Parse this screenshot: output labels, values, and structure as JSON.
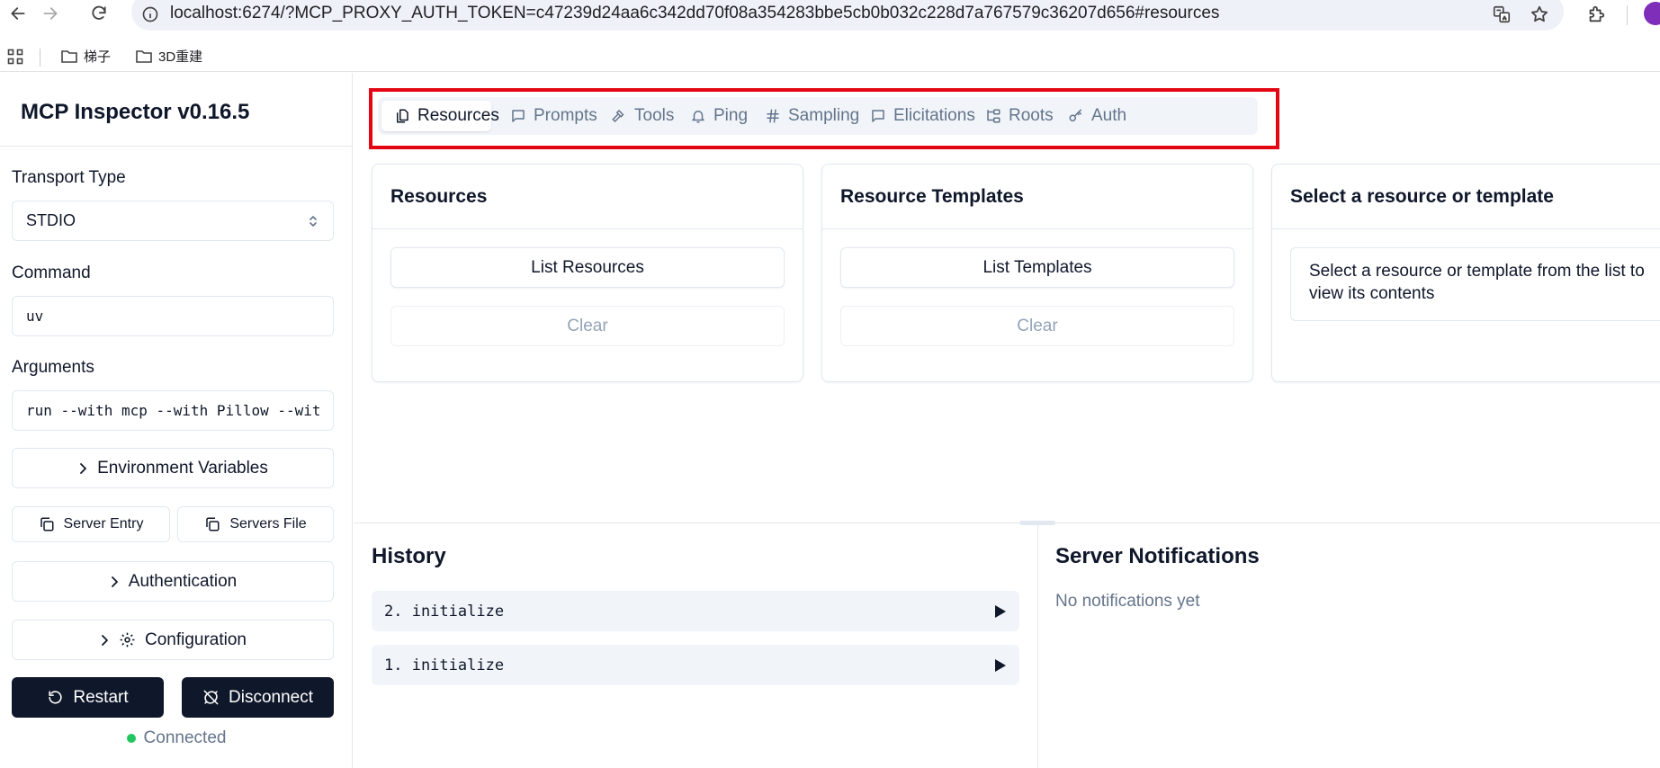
{
  "browser": {
    "url": "localhost:6274/?MCP_PROXY_AUTH_TOKEN=c47239d24aa6c342dd70f08a354283bbe5cb0b032c228d7a767579c36207d656#resources",
    "bookmarks": [
      {
        "label": "梯子"
      },
      {
        "label": "3D重建"
      }
    ]
  },
  "sidebar": {
    "title": "MCP Inspector v0.16.5",
    "transport_label": "Transport Type",
    "transport_value": "STDIO",
    "command_label": "Command",
    "command_value": "uv",
    "arguments_label": "Arguments",
    "arguments_value": "run --with mcp --with Pillow --wit",
    "env_label": "Environment Variables",
    "server_entry_label": "Server Entry",
    "servers_file_label": "Servers File",
    "auth_label": "Authentication",
    "config_label": "Configuration",
    "restart_label": "Restart",
    "disconnect_label": "Disconnect",
    "status_text": "Connected",
    "status_color": "#22c55e"
  },
  "tabs": [
    {
      "label": "Resources",
      "icon": "files-icon",
      "active": true
    },
    {
      "label": "Prompts",
      "icon": "message-square-icon"
    },
    {
      "label": "Tools",
      "icon": "hammer-icon"
    },
    {
      "label": "Ping",
      "icon": "bell-icon"
    },
    {
      "label": "Sampling",
      "icon": "hash-icon"
    },
    {
      "label": "Elicitations",
      "icon": "message-square-icon"
    },
    {
      "label": "Roots",
      "icon": "folder-tree-icon"
    },
    {
      "label": "Auth",
      "icon": "key-icon"
    }
  ],
  "highlight_color": "#e30613",
  "resources_card": {
    "title": "Resources",
    "list_label": "List Resources",
    "clear_label": "Clear"
  },
  "templates_card": {
    "title": "Resource Templates",
    "list_label": "List Templates",
    "clear_label": "Clear"
  },
  "detail_card": {
    "title": "Select a resource or template",
    "message_line1": "Select a resource or template from the list to",
    "message_line2": "view its contents"
  },
  "history": {
    "title": "History",
    "items": [
      {
        "label": "2. initialize"
      },
      {
        "label": "1. initialize"
      }
    ]
  },
  "notifications": {
    "title": "Server Notifications",
    "empty_text": "No notifications yet"
  },
  "colors": {
    "primary_dark": "#0f172a",
    "muted_text": "#64748b"
  }
}
